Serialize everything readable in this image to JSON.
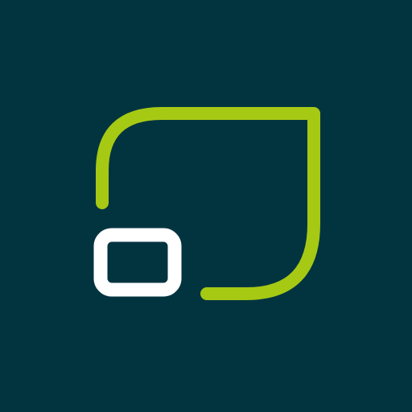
{
  "app_icon": {
    "icon": "leaf-window-logo-icon",
    "colors": {
      "background": "#023440",
      "accent": "#A6C914",
      "foreground": "#FFFFFF"
    }
  }
}
